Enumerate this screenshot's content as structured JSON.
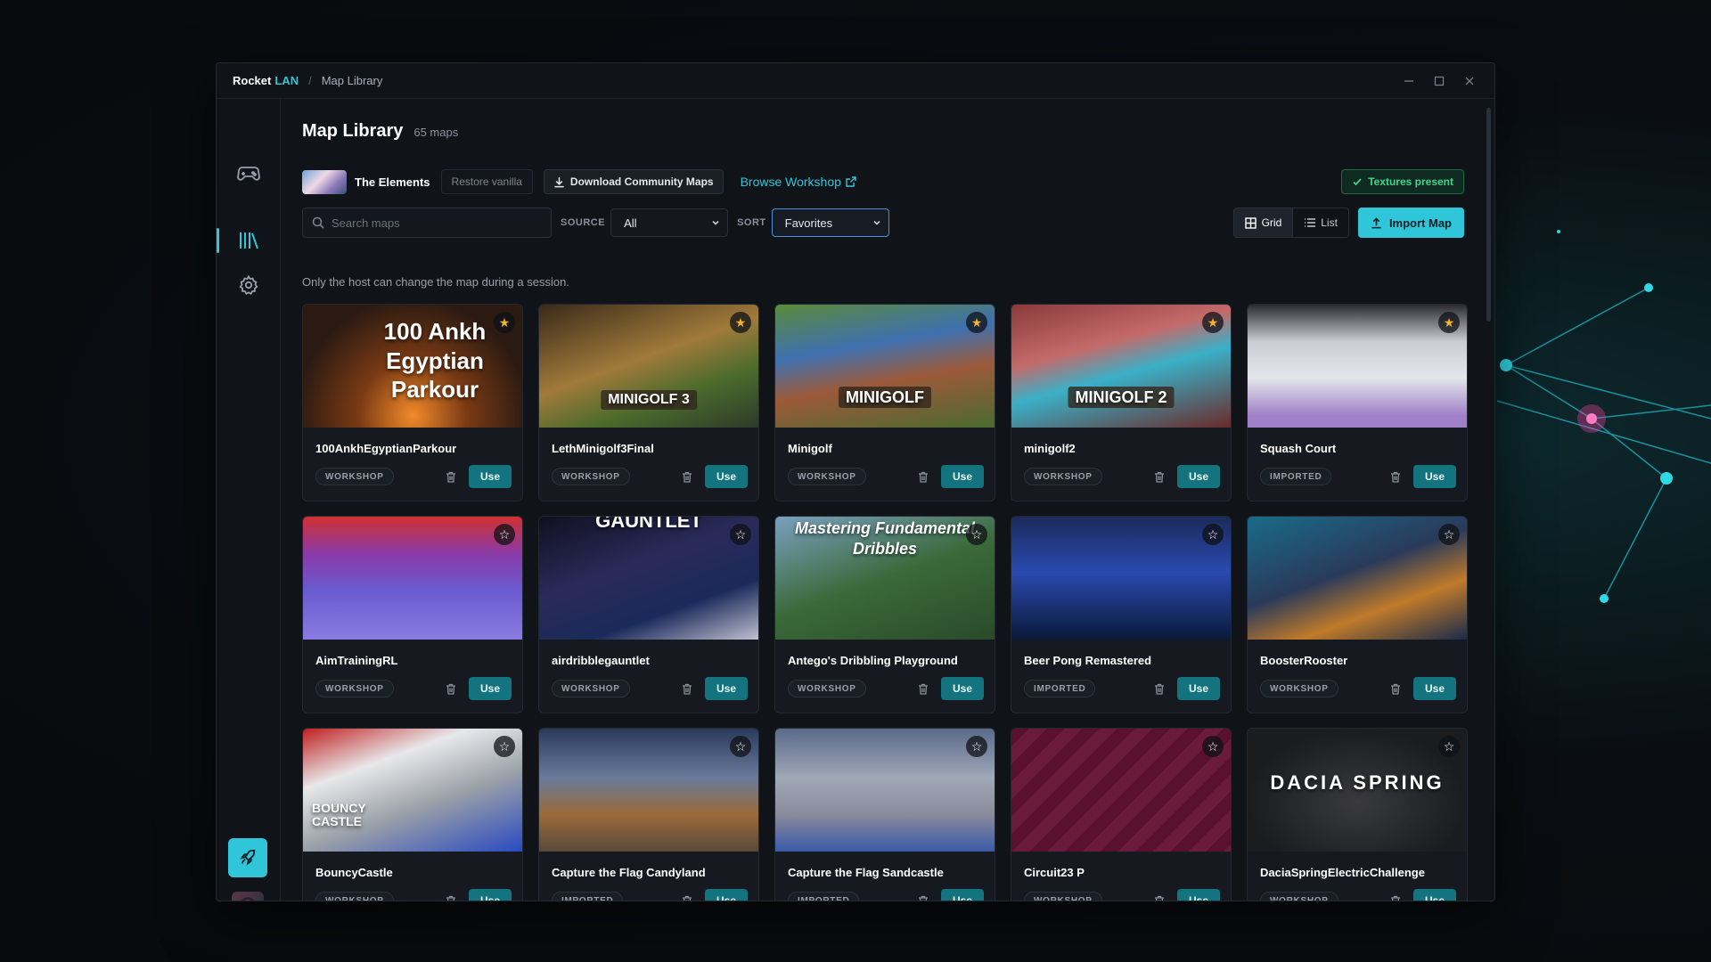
{
  "app": {
    "name": "Rocket",
    "name_accent": "LAN",
    "breadcrumb": "Map Library"
  },
  "window_controls": {
    "minimize": "—",
    "maximize": "☐",
    "close": "✕"
  },
  "header": {
    "title": "Map Library",
    "count": "65 maps"
  },
  "toolbar": {
    "theme_name": "The Elements",
    "restore_label": "Restore vanilla",
    "download_label": "Download Community Maps",
    "browse_label": "Browse Workshop",
    "textures_status": "Textures present"
  },
  "filters": {
    "search_placeholder": "Search maps",
    "source_label": "SOURCE",
    "source_value": "All",
    "sort_label": "SORT",
    "sort_value": "Favorites",
    "view_grid": "Grid",
    "view_list": "List",
    "import_label": "Import Map"
  },
  "note": "Only the host can change the map during a session.",
  "use_label": "Use",
  "accent_color": "#2fc6d9",
  "maps": [
    {
      "name": "100AnkhEgyptianParkour",
      "source": "WORKSHOP",
      "favorite": true,
      "thumb_text": "100 Ankh Egyptian Parkour"
    },
    {
      "name": "LethMinigolf3Final",
      "source": "WORKSHOP",
      "favorite": true,
      "thumb_text": "MINIGOLF 3"
    },
    {
      "name": "Minigolf",
      "source": "WORKSHOP",
      "favorite": true,
      "thumb_text": "MINIGOLF"
    },
    {
      "name": "minigolf2",
      "source": "WORKSHOP",
      "favorite": true,
      "thumb_text": "MINIGOLF 2"
    },
    {
      "name": "Squash Court",
      "source": "IMPORTED",
      "favorite": true,
      "thumb_text": ""
    },
    {
      "name": "AimTrainingRL",
      "source": "WORKSHOP",
      "favorite": false,
      "thumb_text": ""
    },
    {
      "name": "airdribblegauntlet",
      "source": "WORKSHOP",
      "favorite": false,
      "thumb_text": "GAUNTLET"
    },
    {
      "name": "Antego's Dribbling Playground",
      "source": "WORKSHOP",
      "favorite": false,
      "thumb_text": "Mastering Fundamental Dribbles"
    },
    {
      "name": "Beer Pong Remastered",
      "source": "IMPORTED",
      "favorite": false,
      "thumb_text": ""
    },
    {
      "name": "BoosterRooster",
      "source": "WORKSHOP",
      "favorite": false,
      "thumb_text": ""
    },
    {
      "name": "BouncyCastle",
      "source": "WORKSHOP",
      "favorite": false,
      "thumb_text": "BOUNCY CASTLE"
    },
    {
      "name": "Capture the Flag Candyland",
      "source": "IMPORTED",
      "favorite": false,
      "thumb_text": ""
    },
    {
      "name": "Capture the Flag Sandcastle",
      "source": "IMPORTED",
      "favorite": false,
      "thumb_text": ""
    },
    {
      "name": "Circuit23 P",
      "source": "WORKSHOP",
      "favorite": false,
      "thumb_text": ""
    },
    {
      "name": "DaciaSpringElectricChallenge",
      "source": "WORKSHOP",
      "favorite": false,
      "thumb_text": "DACIA SPRING"
    }
  ]
}
